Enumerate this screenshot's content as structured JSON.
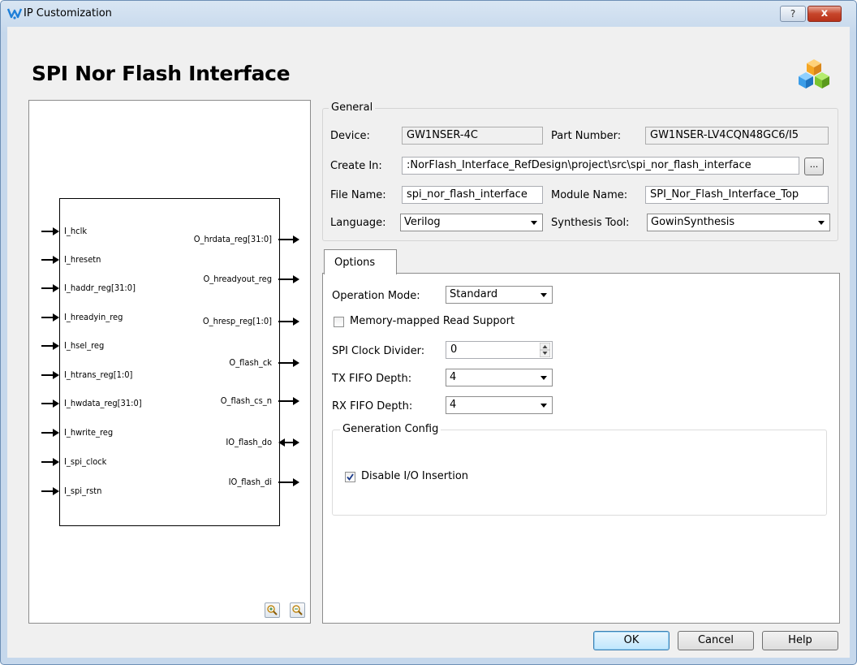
{
  "window": {
    "title": "IP Customization",
    "help_glyph": "?",
    "close_glyph": "x"
  },
  "heading": "SPI Nor Flash Interface",
  "general": {
    "legend": "General",
    "device_label": "Device:",
    "device_value": "GW1NSER-4C",
    "part_label": "Part Number:",
    "part_value": "GW1NSER-LV4CQN48GC6/I5",
    "create_label": "Create In:",
    "create_value": ":NorFlash_Interface_RefDesign\\project\\src\\spi_nor_flash_interface",
    "browse_label": "...",
    "file_label": "File Name:",
    "file_value": "spi_nor_flash_interface",
    "module_label": "Module Name:",
    "module_value": "SPI_Nor_Flash_Interface_Top",
    "language_label": "Language:",
    "language_value": "Verilog",
    "synth_label": "Synthesis Tool:",
    "synth_value": "GowinSynthesis"
  },
  "options": {
    "tab_label": "Options",
    "op_mode_label": "Operation Mode:",
    "op_mode_value": "Standard",
    "mmr_label": "Memory-mapped Read Support",
    "mmr_checked": false,
    "clk_div_label": "SPI Clock Divider:",
    "clk_div_value": "0",
    "tx_label": "TX FIFO Depth:",
    "tx_value": "4",
    "rx_label": "RX FIFO Depth:",
    "rx_value": "4",
    "gen_legend": "Generation Config",
    "disable_io_label": "Disable I/O Insertion",
    "disable_io_checked": true
  },
  "diagram": {
    "inputs": [
      "I_hclk",
      "I_hresetn",
      "I_haddr_reg[31:0]",
      "I_hreadyin_reg",
      "I_hsel_reg",
      "I_htrans_reg[1:0]",
      "I_hwdata_reg[31:0]",
      "I_hwrite_reg",
      "I_spi_clock",
      "I_spi_rstn"
    ],
    "outputs": [
      "O_hrdata_reg[31:0]",
      "O_hreadyout_reg",
      "O_hresp_reg[1:0]",
      "O_flash_ck",
      "O_flash_cs_n",
      "IO_flash_do",
      "IO_flash_di"
    ]
  },
  "buttons": {
    "ok": "OK",
    "cancel": "Cancel",
    "help": "Help"
  },
  "colors": {
    "title_bar": "#c6d8ec",
    "close_button": "#c7452b",
    "default_button": "#bee6fd"
  }
}
